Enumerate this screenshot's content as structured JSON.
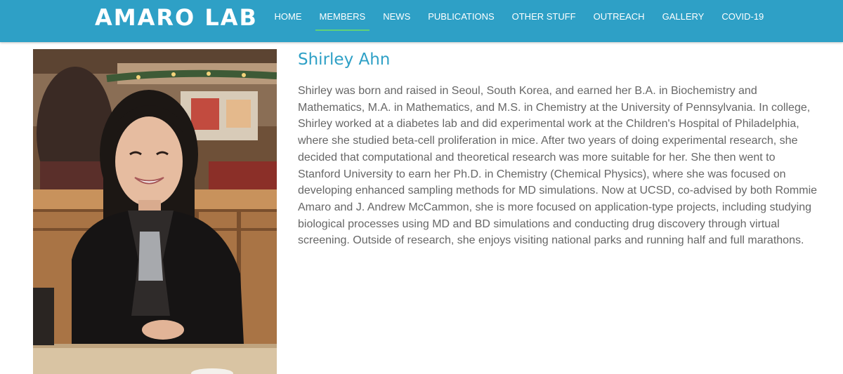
{
  "site": {
    "logo": "AMARO LAB",
    "header_color": "#2ea0c6",
    "active_indicator_color": "#5fd17a"
  },
  "nav": {
    "items": [
      {
        "label": "HOME",
        "active": false
      },
      {
        "label": "MEMBERS",
        "active": true
      },
      {
        "label": "NEWS",
        "active": false
      },
      {
        "label": "PUBLICATIONS",
        "active": false
      },
      {
        "label": "OTHER STUFF",
        "active": false
      },
      {
        "label": "OUTREACH",
        "active": false
      },
      {
        "label": "GALLERY",
        "active": false
      },
      {
        "label": "COVID-19",
        "active": false
      }
    ]
  },
  "member": {
    "name": "Shirley Ahn",
    "photo_icon": "member-portrait",
    "bio": "Shirley was born and raised in Seoul, South Korea, and earned her B.A. in Biochemistry and Mathematics, M.A. in Mathematics, and M.S. in Chemistry at the University of Pennsylvania. In college, Shirley worked at a diabetes lab and did experimental work at the Children's Hospital of Philadelphia, where she studied beta-cell proliferation in mice. After two years of doing experimental research, she decided that computational and theoretical research was more suitable for her. She then went to Stanford University to earn her Ph.D. in Chemistry (Chemical Physics), where she was focused on developing enhanced sampling methods for MD simulations. Now at UCSD, co-advised by both Rommie Amaro and J. Andrew McCammon, she is more focused on application-type projects, including studying biological processes using MD and BD simulations and conducting drug discovery through virtual screening. Outside of research, she enjoys visiting national parks and running half and full marathons."
  }
}
